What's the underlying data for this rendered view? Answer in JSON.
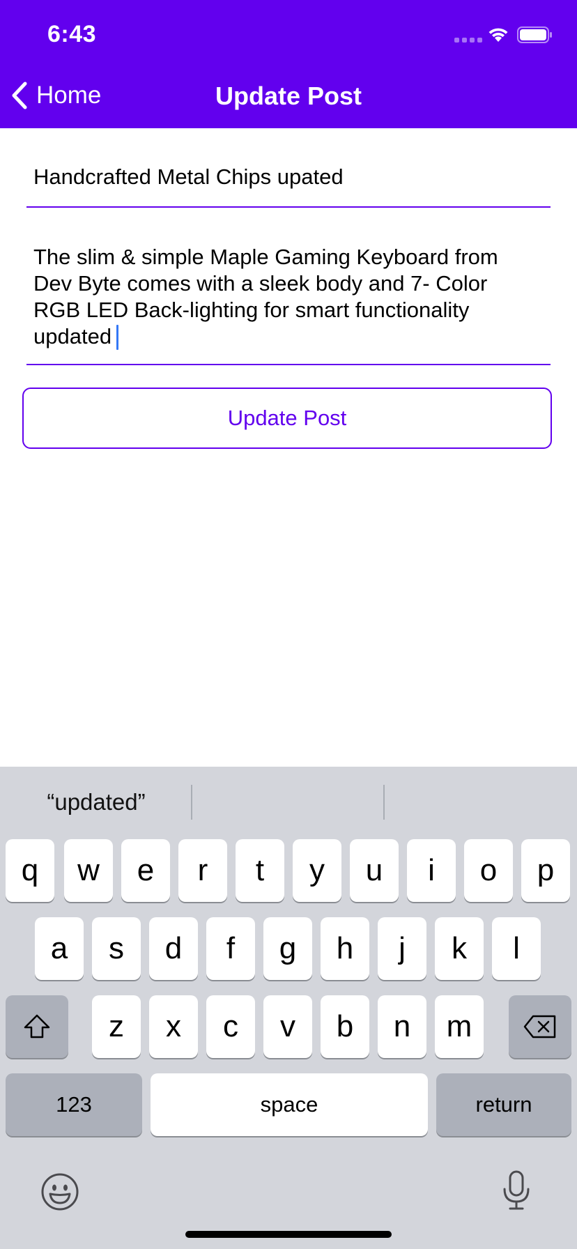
{
  "status_bar": {
    "time": "6:43"
  },
  "nav": {
    "back_label": "Home",
    "title": "Update Post"
  },
  "form": {
    "title_value": "Handcrafted Metal Chips upated",
    "body_value": "The slim & simple Maple Gaming Keyboard from\nDev Byte comes with a sleek body and 7- Color\nRGB LED Back-lighting for smart functionality\nupdated",
    "submit_label": "Update Post"
  },
  "keyboard": {
    "suggestions": [
      "“updated”",
      "",
      ""
    ],
    "row1": [
      "q",
      "w",
      "e",
      "r",
      "t",
      "y",
      "u",
      "i",
      "o",
      "p"
    ],
    "row2": [
      "a",
      "s",
      "d",
      "f",
      "g",
      "h",
      "j",
      "k",
      "l"
    ],
    "row3": [
      "z",
      "x",
      "c",
      "v",
      "b",
      "n",
      "m"
    ],
    "numbers_label": "123",
    "space_label": "space",
    "return_label": "return"
  },
  "colors": {
    "accent": "#6200EE",
    "keyboard_bg": "#D3D5DB",
    "caret": "#3478F6"
  }
}
